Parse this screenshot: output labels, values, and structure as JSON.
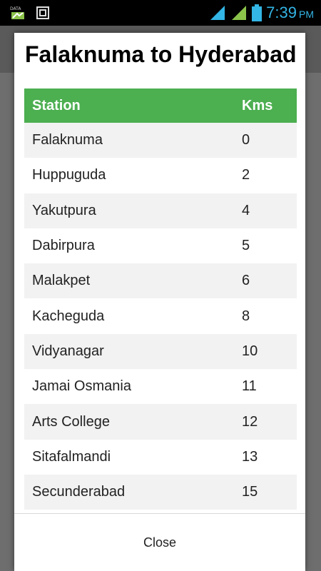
{
  "status_bar": {
    "left_icons": [
      "data-icon",
      "notification-icon"
    ],
    "time": "7:39",
    "ampm": "PM",
    "accent_color": "#33b5e5"
  },
  "dialog": {
    "title": "Falaknuma to Hyderabad",
    "header_color": "#4caf50",
    "columns": [
      "Station",
      "Kms"
    ],
    "rows": [
      {
        "station": "Falaknuma",
        "kms": "0"
      },
      {
        "station": "Huppuguda",
        "kms": "2"
      },
      {
        "station": "Yakutpura",
        "kms": "4"
      },
      {
        "station": "Dabirpura",
        "kms": "5"
      },
      {
        "station": "Malakpet",
        "kms": "6"
      },
      {
        "station": "Kacheguda",
        "kms": "8"
      },
      {
        "station": "Vidyanagar",
        "kms": "10"
      },
      {
        "station": "Jamai Osmania",
        "kms": "11"
      },
      {
        "station": "Arts College",
        "kms": "12"
      },
      {
        "station": "Sitafalmandi",
        "kms": "13"
      },
      {
        "station": "Secunderabad",
        "kms": "15"
      }
    ],
    "close_label": "Close"
  }
}
